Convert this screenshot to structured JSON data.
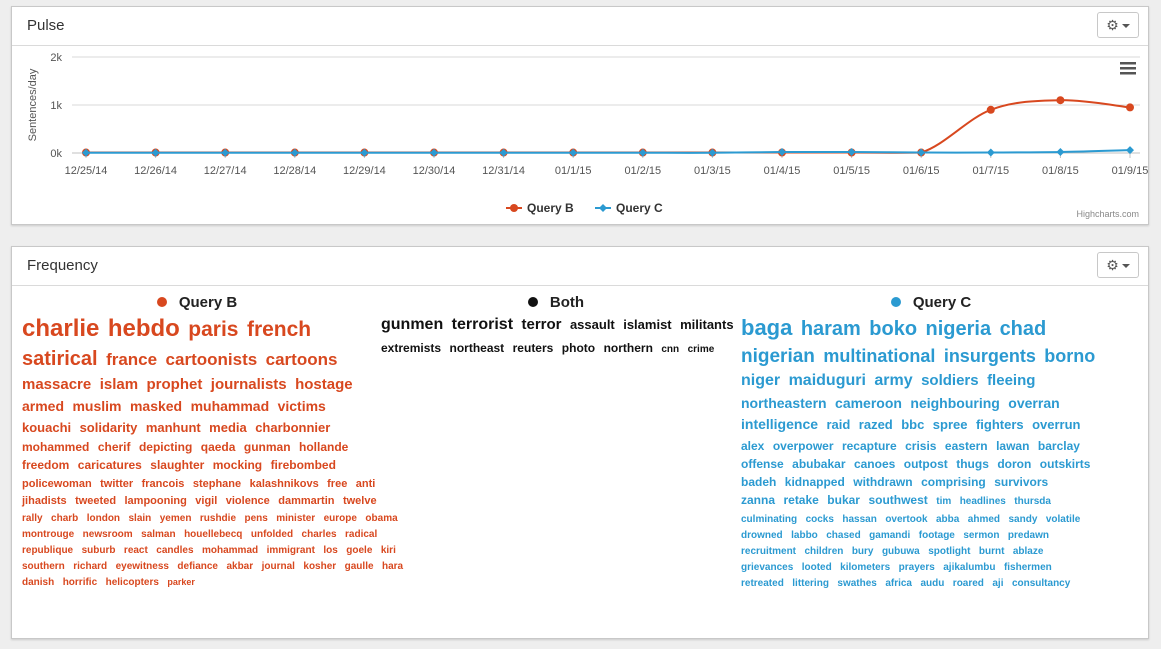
{
  "pulse": {
    "title": "Pulse",
    "menu_icon": "hamburger-icon",
    "settings_icon": "gear-icon",
    "credit": "Highcharts.com"
  },
  "frequency": {
    "title": "Frequency",
    "settings_icon": "gear-icon",
    "columns": [
      {
        "name": "Query B",
        "color": "#d8481f",
        "rows": [
          [
            {
              "w": "charlie",
              "s": 24
            },
            {
              "w": "hebdo",
              "s": 24
            },
            {
              "w": "paris",
              "s": 21
            },
            {
              "w": "french",
              "s": 21
            }
          ],
          [
            {
              "w": "satirical",
              "s": 20
            },
            {
              "w": "france",
              "s": 17
            },
            {
              "w": "cartoonists",
              "s": 17
            },
            {
              "w": "cartoons",
              "s": 17
            }
          ],
          [
            {
              "w": "massacre",
              "s": 15
            },
            {
              "w": "islam",
              "s": 15
            },
            {
              "w": "prophet",
              "s": 15
            },
            {
              "w": "journalists",
              "s": 15
            },
            {
              "w": "hostage",
              "s": 15
            }
          ],
          [
            {
              "w": "armed",
              "s": 14
            },
            {
              "w": "muslim",
              "s": 14
            },
            {
              "w": "masked",
              "s": 14
            },
            {
              "w": "muhammad",
              "s": 14
            },
            {
              "w": "victims",
              "s": 14
            }
          ],
          [
            {
              "w": "kouachi",
              "s": 13
            },
            {
              "w": "solidarity",
              "s": 13
            },
            {
              "w": "manhunt",
              "s": 13
            },
            {
              "w": "media",
              "s": 13
            },
            {
              "w": "charbonnier",
              "s": 13
            }
          ],
          [
            {
              "w": "mohammed",
              "s": 12
            },
            {
              "w": "cherif",
              "s": 12
            },
            {
              "w": "depicting",
              "s": 12
            },
            {
              "w": "qaeda",
              "s": 12
            },
            {
              "w": "gunman",
              "s": 12
            },
            {
              "w": "hollande",
              "s": 12
            }
          ],
          [
            {
              "w": "freedom",
              "s": 12
            },
            {
              "w": "caricatures",
              "s": 12
            },
            {
              "w": "slaughter",
              "s": 12
            },
            {
              "w": "mocking",
              "s": 12
            },
            {
              "w": "firebombed",
              "s": 12
            }
          ],
          [
            {
              "w": "policewoman",
              "s": 11
            },
            {
              "w": "twitter",
              "s": 11
            },
            {
              "w": "francois",
              "s": 11
            },
            {
              "w": "stephane",
              "s": 11
            },
            {
              "w": "kalashnikovs",
              "s": 11
            },
            {
              "w": "free",
              "s": 11
            },
            {
              "w": "anti",
              "s": 11
            }
          ],
          [
            {
              "w": "jihadists",
              "s": 11
            },
            {
              "w": "tweeted",
              "s": 11
            },
            {
              "w": "lampooning",
              "s": 11
            },
            {
              "w": "vigil",
              "s": 11
            },
            {
              "w": "violence",
              "s": 11
            },
            {
              "w": "dammartin",
              "s": 11
            },
            {
              "w": "twelve",
              "s": 11
            }
          ],
          [
            {
              "w": "rally",
              "s": 10
            },
            {
              "w": "charb",
              "s": 10
            },
            {
              "w": "london",
              "s": 10
            },
            {
              "w": "slain",
              "s": 10
            },
            {
              "w": "yemen",
              "s": 10
            },
            {
              "w": "rushdie",
              "s": 10
            },
            {
              "w": "pens",
              "s": 10
            },
            {
              "w": "minister",
              "s": 10
            },
            {
              "w": "europe",
              "s": 10
            },
            {
              "w": "obama",
              "s": 10
            }
          ],
          [
            {
              "w": "montrouge",
              "s": 10
            },
            {
              "w": "newsroom",
              "s": 10
            },
            {
              "w": "salman",
              "s": 10
            },
            {
              "w": "houellebecq",
              "s": 10
            },
            {
              "w": "unfolded",
              "s": 10
            },
            {
              "w": "charles",
              "s": 10
            },
            {
              "w": "radical",
              "s": 10
            }
          ],
          [
            {
              "w": "republique",
              "s": 10
            },
            {
              "w": "suburb",
              "s": 10
            },
            {
              "w": "react",
              "s": 10
            },
            {
              "w": "candles",
              "s": 10
            },
            {
              "w": "mohammad",
              "s": 10
            },
            {
              "w": "immigrant",
              "s": 10
            },
            {
              "w": "los",
              "s": 10
            },
            {
              "w": "goele",
              "s": 10
            },
            {
              "w": "kiri",
              "s": 10
            }
          ],
          [
            {
              "w": "southern",
              "s": 10
            },
            {
              "w": "richard",
              "s": 10
            },
            {
              "w": "eyewitness",
              "s": 10
            },
            {
              "w": "defiance",
              "s": 10
            },
            {
              "w": "akbar",
              "s": 10
            },
            {
              "w": "journal",
              "s": 10
            },
            {
              "w": "kosher",
              "s": 10
            },
            {
              "w": "gaulle",
              "s": 10
            },
            {
              "w": "hara",
              "s": 10
            }
          ],
          [
            {
              "w": "danish",
              "s": 10
            },
            {
              "w": "horrific",
              "s": 10
            },
            {
              "w": "helicopters",
              "s": 10
            },
            {
              "w": "parker",
              "s": 9
            }
          ]
        ]
      },
      {
        "name": "Both",
        "color": "#111111",
        "rows": [
          [
            {
              "w": "gunmen",
              "s": 16
            },
            {
              "w": "terrorist",
              "s": 16
            },
            {
              "w": "terror",
              "s": 15
            },
            {
              "w": "assault",
              "s": 13
            },
            {
              "w": "islamist",
              "s": 13
            },
            {
              "w": "militants",
              "s": 13
            }
          ],
          [
            {
              "w": "extremists",
              "s": 12
            },
            {
              "w": "northeast",
              "s": 12
            },
            {
              "w": "reuters",
              "s": 12
            },
            {
              "w": "photo",
              "s": 12
            },
            {
              "w": "northern",
              "s": 12
            },
            {
              "w": "cnn",
              "s": 10
            },
            {
              "w": "crime",
              "s": 10
            }
          ]
        ]
      },
      {
        "name": "Query C",
        "color": "#2b9ad1",
        "rows": [
          [
            {
              "w": "baga",
              "s": 22
            },
            {
              "w": "haram",
              "s": 20
            },
            {
              "w": "boko",
              "s": 20
            },
            {
              "w": "nigeria",
              "s": 20
            },
            {
              "w": "chad",
              "s": 20
            }
          ],
          [
            {
              "w": "nigerian",
              "s": 19
            },
            {
              "w": "multinational",
              "s": 18
            },
            {
              "w": "insurgents",
              "s": 18
            },
            {
              "w": "borno",
              "s": 18
            }
          ],
          [
            {
              "w": "niger",
              "s": 16
            },
            {
              "w": "maiduguri",
              "s": 16
            },
            {
              "w": "army",
              "s": 16
            },
            {
              "w": "soldiers",
              "s": 15
            },
            {
              "w": "fleeing",
              "s": 15
            }
          ],
          [
            {
              "w": "northeastern",
              "s": 14
            },
            {
              "w": "cameroon",
              "s": 14
            },
            {
              "w": "neighbouring",
              "s": 14
            },
            {
              "w": "overran",
              "s": 14
            }
          ],
          [
            {
              "w": "intelligence",
              "s": 14
            },
            {
              "w": "raid",
              "s": 13
            },
            {
              "w": "razed",
              "s": 13
            },
            {
              "w": "bbc",
              "s": 13
            },
            {
              "w": "spree",
              "s": 13
            },
            {
              "w": "fighters",
              "s": 13
            },
            {
              "w": "overrun",
              "s": 13
            }
          ],
          [
            {
              "w": "alex",
              "s": 12
            },
            {
              "w": "overpower",
              "s": 12
            },
            {
              "w": "recapture",
              "s": 12
            },
            {
              "w": "crisis",
              "s": 12
            },
            {
              "w": "eastern",
              "s": 12
            },
            {
              "w": "lawan",
              "s": 12
            },
            {
              "w": "barclay",
              "s": 12
            }
          ],
          [
            {
              "w": "offense",
              "s": 12
            },
            {
              "w": "abubakar",
              "s": 12
            },
            {
              "w": "canoes",
              "s": 12
            },
            {
              "w": "outpost",
              "s": 12
            },
            {
              "w": "thugs",
              "s": 12
            },
            {
              "w": "doron",
              "s": 12
            },
            {
              "w": "outskirts",
              "s": 12
            }
          ],
          [
            {
              "w": "badeh",
              "s": 12
            },
            {
              "w": "kidnapped",
              "s": 12
            },
            {
              "w": "withdrawn",
              "s": 12
            },
            {
              "w": "comprising",
              "s": 12
            },
            {
              "w": "survivors",
              "s": 12
            }
          ],
          [
            {
              "w": "zanna",
              "s": 12
            },
            {
              "w": "retake",
              "s": 12
            },
            {
              "w": "bukar",
              "s": 12
            },
            {
              "w": "southwest",
              "s": 12
            },
            {
              "w": "tim",
              "s": 10
            },
            {
              "w": "headlines",
              "s": 10
            },
            {
              "w": "thursda",
              "s": 10
            }
          ],
          [
            {
              "w": "culminating",
              "s": 10
            },
            {
              "w": "cocks",
              "s": 10
            },
            {
              "w": "hassan",
              "s": 10
            },
            {
              "w": "overtook",
              "s": 10
            },
            {
              "w": "abba",
              "s": 10
            },
            {
              "w": "ahmed",
              "s": 10
            },
            {
              "w": "sandy",
              "s": 10
            },
            {
              "w": "volatile",
              "s": 10
            }
          ],
          [
            {
              "w": "drowned",
              "s": 10
            },
            {
              "w": "labbo",
              "s": 10
            },
            {
              "w": "chased",
              "s": 10
            },
            {
              "w": "gamandi",
              "s": 10
            },
            {
              "w": "footage",
              "s": 10
            },
            {
              "w": "sermon",
              "s": 10
            },
            {
              "w": "predawn",
              "s": 10
            }
          ],
          [
            {
              "w": "recruitment",
              "s": 10
            },
            {
              "w": "children",
              "s": 10
            },
            {
              "w": "bury",
              "s": 10
            },
            {
              "w": "gubuwa",
              "s": 10
            },
            {
              "w": "spotlight",
              "s": 10
            },
            {
              "w": "burnt",
              "s": 10
            },
            {
              "w": "ablaze",
              "s": 10
            }
          ],
          [
            {
              "w": "grievances",
              "s": 10
            },
            {
              "w": "looted",
              "s": 10
            },
            {
              "w": "kilometers",
              "s": 10
            },
            {
              "w": "prayers",
              "s": 10
            },
            {
              "w": "ajikalumbu",
              "s": 10
            },
            {
              "w": "fishermen",
              "s": 10
            }
          ],
          [
            {
              "w": "retreated",
              "s": 10
            },
            {
              "w": "littering",
              "s": 10
            },
            {
              "w": "swathes",
              "s": 10
            },
            {
              "w": "africa",
              "s": 10
            },
            {
              "w": "audu",
              "s": 10
            },
            {
              "w": "roared",
              "s": 10
            },
            {
              "w": "aji",
              "s": 10
            },
            {
              "w": "consultancy",
              "s": 10
            }
          ]
        ]
      }
    ]
  },
  "chart_data": {
    "type": "line",
    "title": "",
    "xlabel": "",
    "ylabel": "Sentences/day",
    "ylim": [
      0,
      2000
    ],
    "yticks": [
      "0k",
      "1k",
      "2k"
    ],
    "grid": true,
    "legend": "bottom-center",
    "categories": [
      "12/25/14",
      "12/26/14",
      "12/27/14",
      "12/28/14",
      "12/29/14",
      "12/30/14",
      "12/31/14",
      "01/1/15",
      "01/2/15",
      "01/3/15",
      "01/4/15",
      "01/5/15",
      "01/6/15",
      "01/7/15",
      "01/8/15",
      "01/9/15"
    ],
    "series": [
      {
        "name": "Query B",
        "color": "#d8481f",
        "values": [
          10,
          10,
          10,
          10,
          10,
          10,
          10,
          10,
          10,
          10,
          10,
          10,
          10,
          900,
          1100,
          950
        ]
      },
      {
        "name": "Query C",
        "color": "#2b9ad1",
        "values": [
          5,
          5,
          5,
          5,
          5,
          5,
          5,
          5,
          5,
          5,
          20,
          20,
          10,
          10,
          20,
          60
        ]
      }
    ]
  }
}
